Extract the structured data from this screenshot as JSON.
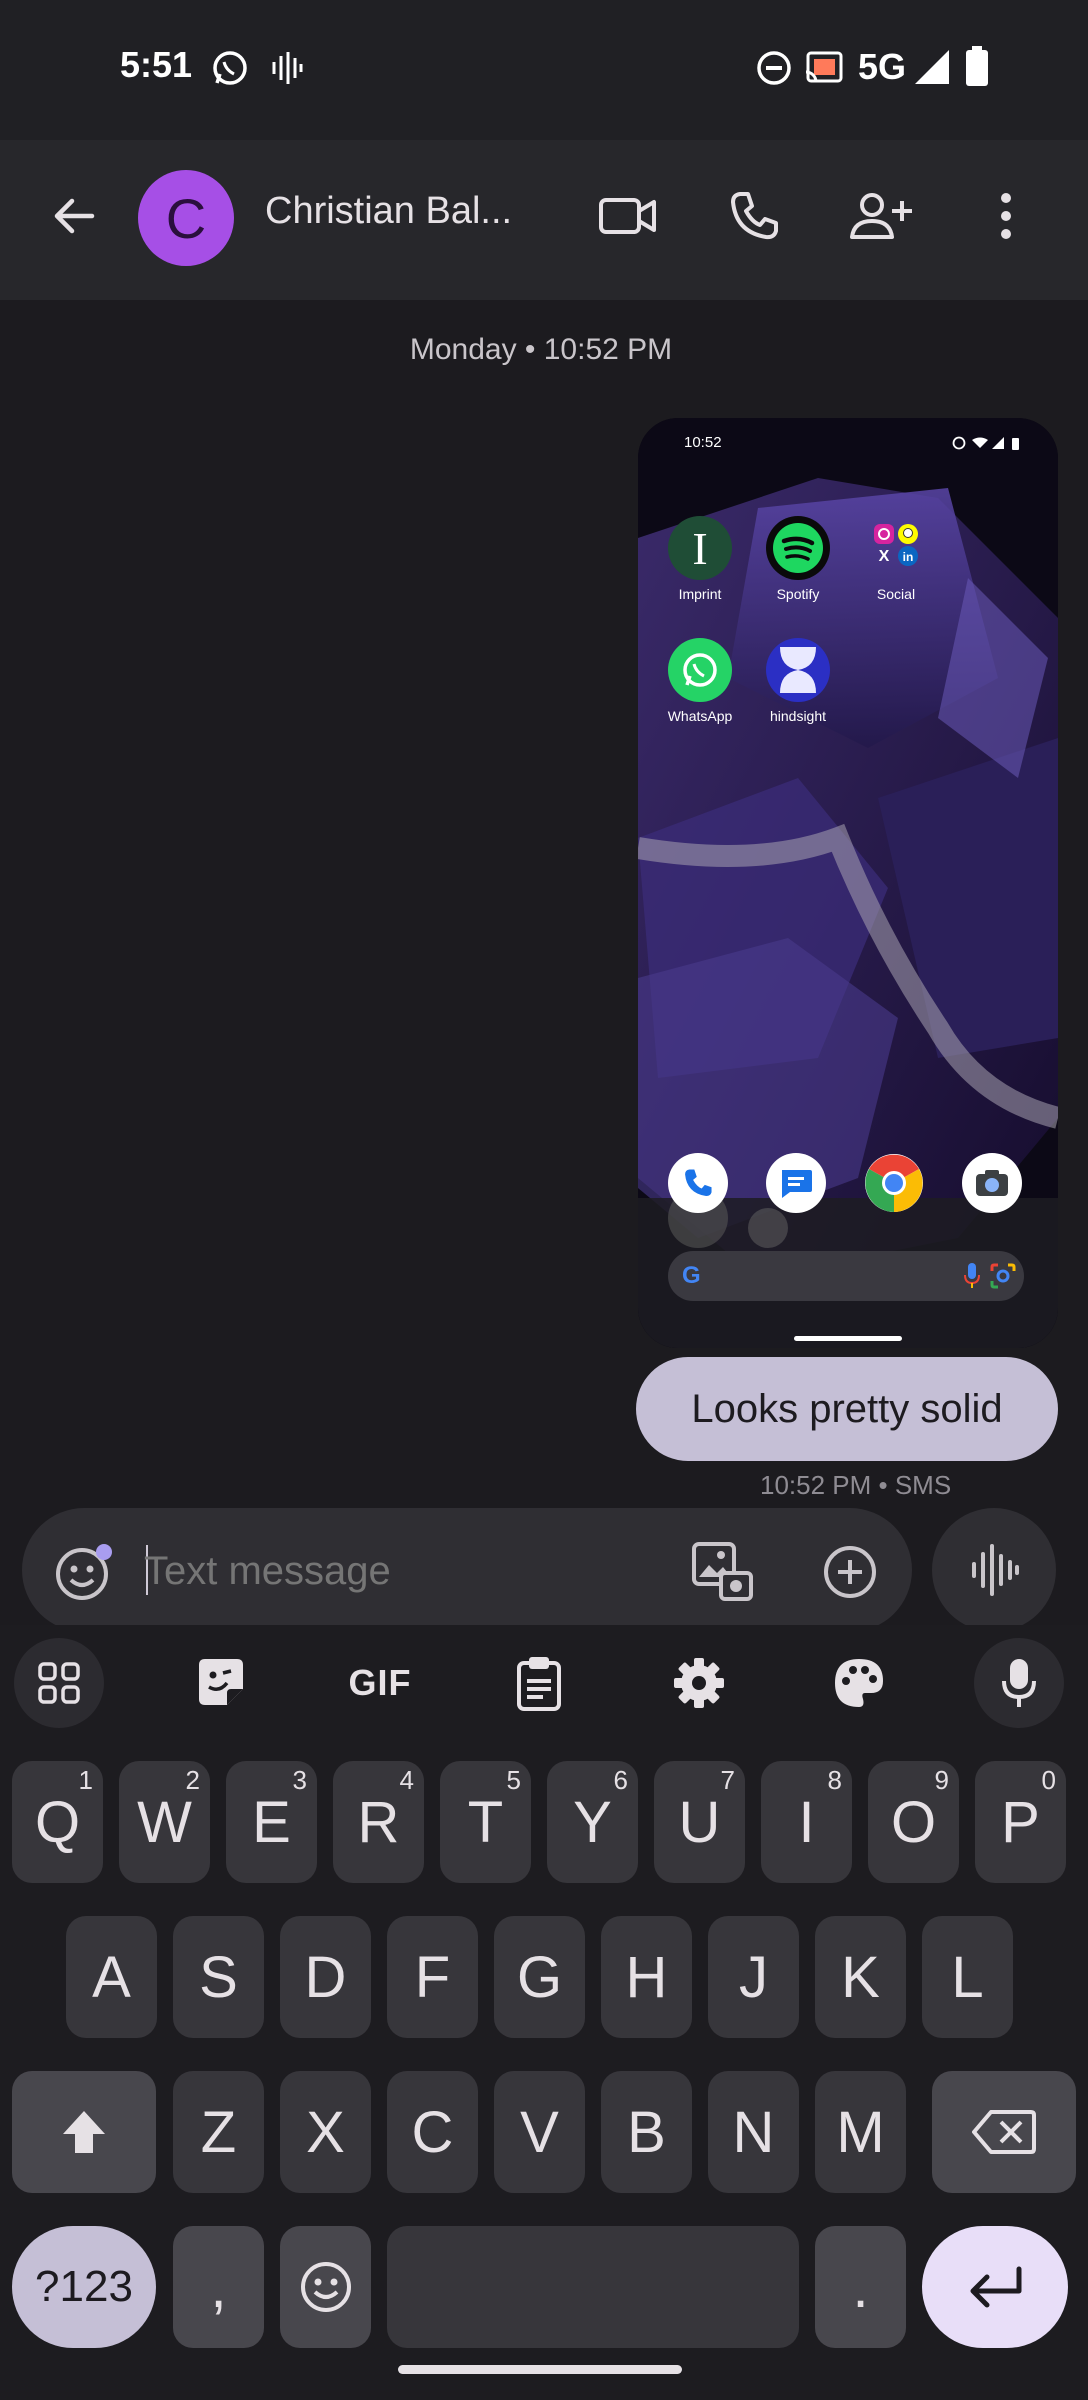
{
  "status_bar": {
    "time": "5:51",
    "network": "5G"
  },
  "header": {
    "avatar_letter": "C",
    "contact_name": "Christian Bal..."
  },
  "conversation": {
    "date_label": "Monday • 10:52 PM",
    "screenshot": {
      "time": "10:52",
      "apps": [
        "Imprint",
        "Spotify",
        "Social",
        "WhatsApp",
        "hindsight"
      ]
    },
    "message_text": "Looks pretty solid",
    "message_meta": "10:52 PM • SMS"
  },
  "compose": {
    "placeholder": "Text message"
  },
  "keyboard": {
    "toolbar_gif": "GIF",
    "row1": [
      {
        "k": "Q",
        "h": "1"
      },
      {
        "k": "W",
        "h": "2"
      },
      {
        "k": "E",
        "h": "3"
      },
      {
        "k": "R",
        "h": "4"
      },
      {
        "k": "T",
        "h": "5"
      },
      {
        "k": "Y",
        "h": "6"
      },
      {
        "k": "U",
        "h": "7"
      },
      {
        "k": "I",
        "h": "8"
      },
      {
        "k": "O",
        "h": "9"
      },
      {
        "k": "P",
        "h": "0"
      }
    ],
    "row2": [
      "A",
      "S",
      "D",
      "F",
      "G",
      "H",
      "J",
      "K",
      "L"
    ],
    "row3": [
      "Z",
      "X",
      "C",
      "V",
      "B",
      "N",
      "M"
    ],
    "symbols_key": "?123",
    "comma_key": ",",
    "period_key": "."
  },
  "colors": {
    "accent": "#a64fe6",
    "bubble": "#c5bfd6",
    "enter_key": "#e8def8"
  }
}
